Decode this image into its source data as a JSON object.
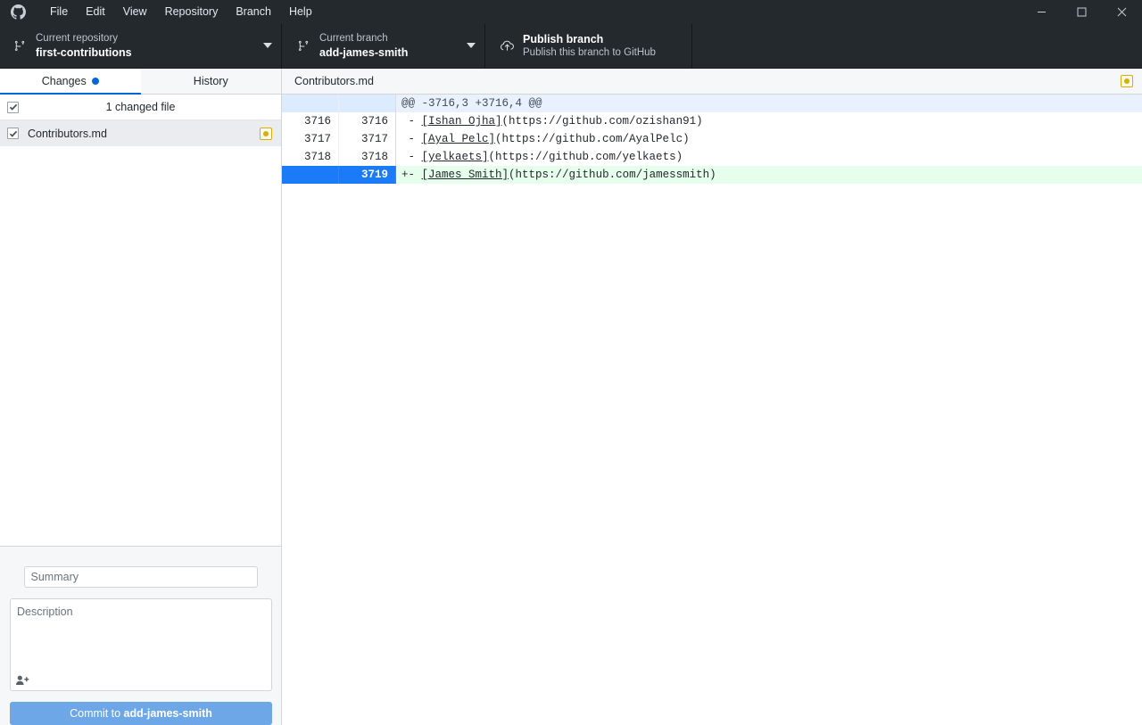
{
  "window": {
    "app_icon": "github-logo-icon",
    "minimize_icon": "minimize-icon",
    "maximize_icon": "maximize-icon",
    "close_icon": "close-icon"
  },
  "menubar": {
    "items": [
      {
        "label": "File"
      },
      {
        "label": "Edit"
      },
      {
        "label": "View"
      },
      {
        "label": "Repository"
      },
      {
        "label": "Branch"
      },
      {
        "label": "Help"
      }
    ]
  },
  "toolbar": {
    "repository": {
      "icon": "repo-icon",
      "label": "Current repository",
      "value": "first-contributions",
      "caret_icon": "chevron-down-icon"
    },
    "branch": {
      "icon": "branch-icon",
      "label": "Current branch",
      "value": "add-james-smith",
      "caret_icon": "chevron-down-icon"
    },
    "publish": {
      "icon": "cloud-upload-icon",
      "title": "Publish branch",
      "subtitle": "Publish this branch to GitHub"
    }
  },
  "sidebar": {
    "tabs": [
      {
        "label": "Changes",
        "active": true,
        "has_dot": true
      },
      {
        "label": "History",
        "active": false,
        "has_dot": false
      }
    ],
    "changed_files_summary": "1 changed file",
    "select_all_checked": true,
    "files": [
      {
        "name": "Contributors.md",
        "checked": true,
        "status_icon": "modified-status-icon",
        "status_color": "#dbab09",
        "selected": true
      }
    ]
  },
  "commit_form": {
    "summary_placeholder": "Summary",
    "summary_value": "",
    "description_placeholder": "Description",
    "description_value": "",
    "coauthor_icon": "add-coauthor-icon",
    "commit_button_prefix": "Commit to ",
    "commit_button_branch": "add-james-smith",
    "commit_button_color": "#6da7e8"
  },
  "diff": {
    "file_name": "Contributors.md",
    "status_icon": "modified-status-icon",
    "lines": [
      {
        "type": "hunk",
        "old_no": "",
        "new_no": "",
        "marker": "",
        "text": "@@ -3716,3 +3716,4 @@"
      },
      {
        "type": "ctx",
        "old_no": "3716",
        "new_no": "3716",
        "marker": " - ",
        "link_text": "[Ishan Ojha]",
        "url_text": "(https://github.com/ozishan91)"
      },
      {
        "type": "ctx",
        "old_no": "3717",
        "new_no": "3717",
        "marker": " - ",
        "link_text": "[Ayal Pelc]",
        "url_text": "(https://github.com/AyalPelc)"
      },
      {
        "type": "ctx",
        "old_no": "3718",
        "new_no": "3718",
        "marker": " - ",
        "link_text": "[yelkaets]",
        "url_text": "(https://github.com/yelkaets)"
      },
      {
        "type": "add",
        "old_no": "",
        "new_no": "3719",
        "marker": "+- ",
        "link_text": "[James Smith]",
        "url_text": "(https://github.com/jamessmith)"
      }
    ]
  },
  "colors": {
    "chrome_bg": "#24292e",
    "accent_blue": "#0366d6",
    "add_line_bg": "#e6ffec",
    "add_gutter_bg": "#1a7af8",
    "hunk_bg": "#e8f1fd",
    "modified_amber": "#dbab09"
  }
}
